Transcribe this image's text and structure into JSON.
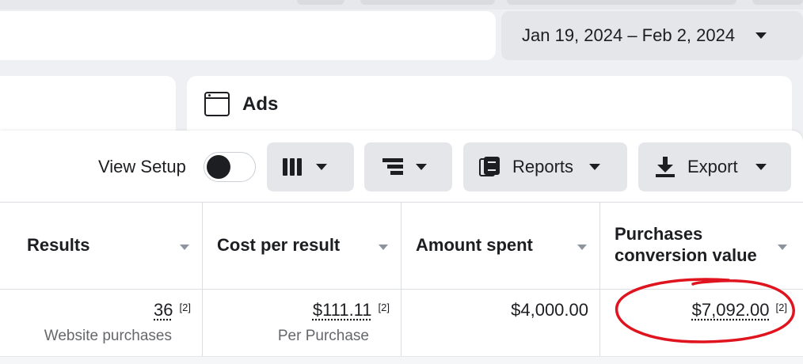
{
  "header": {
    "date_range": "Jan 19, 2024 – Feb 2, 2024"
  },
  "tabs": {
    "ads_label": "Ads"
  },
  "toolbar": {
    "view_setup_label": "View Setup",
    "reports_label": "Reports",
    "export_label": "Export"
  },
  "table": {
    "columns": [
      {
        "title_lines": [
          "Results"
        ]
      },
      {
        "title_lines": [
          "Cost per result"
        ]
      },
      {
        "title_lines": [
          "Amount spent"
        ]
      },
      {
        "title_lines": [
          "Purchases",
          "conversion value"
        ]
      }
    ],
    "row": {
      "results": {
        "value": "36",
        "note": "[2]",
        "sub": "Website purchases"
      },
      "cost_per_result": {
        "value": "$111.11",
        "note": "[2]",
        "sub": "Per Purchase"
      },
      "amount_spent": {
        "value": "$4,000.00"
      },
      "purchases_conversion_value": {
        "value": "$7,092.00",
        "note": "[2]"
      }
    }
  },
  "colors": {
    "highlight": "#e0141e",
    "button_bg": "#e4e6e9",
    "text": "#1c1e21",
    "muted": "#65676b"
  }
}
